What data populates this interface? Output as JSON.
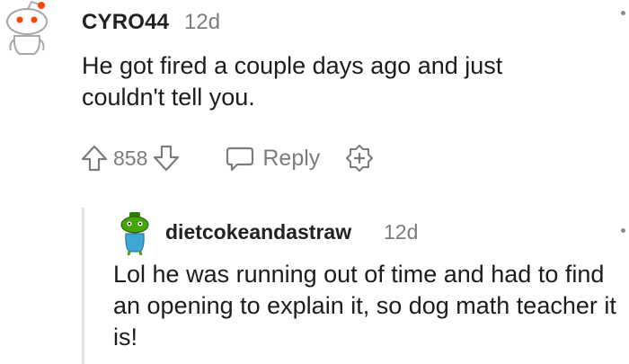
{
  "comment": {
    "username": "CYRO44",
    "timestamp": "12d",
    "body": "He got fired a couple days ago and just couldn't tell you.",
    "actions": {
      "upvote_icon": "arrow-up-icon",
      "score": "858",
      "downvote_icon": "arrow-down-icon",
      "reply_icon": "speech-bubble-icon",
      "reply_label": "Reply",
      "award_icon": "award-plus-icon"
    }
  },
  "reply": {
    "username": "dietcokeandastraw",
    "timestamp": "12d",
    "body": "Lol he was running out of time and had to find an opening to explain it, so dog math teacher it is!"
  },
  "colors": {
    "text": "#1c1c1c",
    "meta": "#7c7c7c",
    "snoo_red": "#ff4500",
    "reply_avatar_green": "#46a508",
    "thread_line": "#e3e3e3"
  }
}
